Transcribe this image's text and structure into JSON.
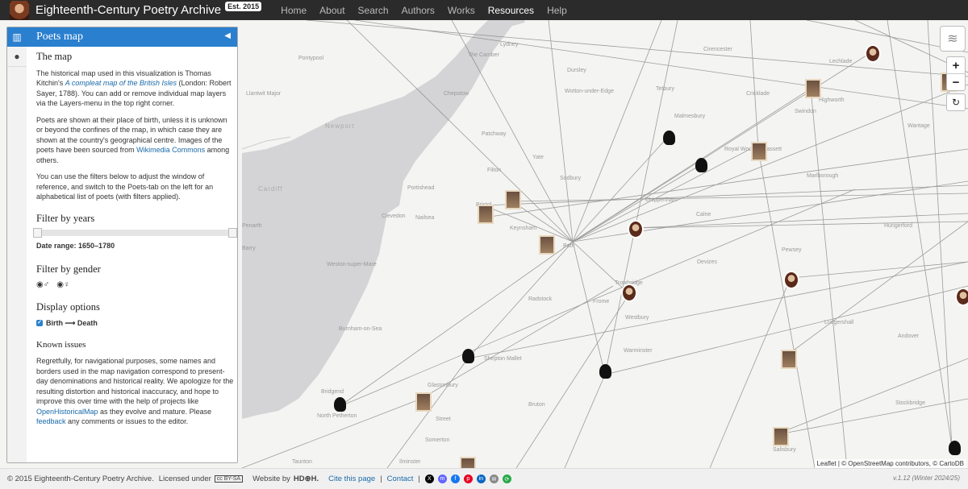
{
  "topnav": {
    "title": "Eighteenth-Century Poetry Archive",
    "badge": "Est. 2015",
    "links": [
      "Home",
      "About",
      "Search",
      "Authors",
      "Works",
      "Resources",
      "Help"
    ],
    "active": "Resources"
  },
  "sidebar": {
    "title": "Poets map",
    "map_heading": "The map",
    "p1_a": "The historical map used in this visualization is Thomas Kitchin's ",
    "p1_link": "A compleat map of the British Isles",
    "p1_b": " (London: Robert Sayer, 1788). You can add or remove individual map layers via the Layers-menu in the top right corner.",
    "p2_a": "Poets are shown at their place of birth, unless it is unknown or beyond the confines of the map, in which case they are shown at the country's geographical centre. Images of the poets have been sourced from ",
    "p2_link": "Wikimedia Commons",
    "p2_b": " among others.",
    "p3": "You can use the filters below to adjust the window of reference, and switch to the Poets-tab on the left for an alphabetical list of poets (with filters applied).",
    "years_heading": "Filter by years",
    "date_range_label": "Date range:",
    "date_range_value": "1650–1780",
    "gender_heading": "Filter by gender",
    "display_heading": "Display options",
    "display_option": "Birth ⟶ Death",
    "issues_heading": "Known issues",
    "issues_a": "Regretfully, for navigational purposes, some names and borders used in the map navigation correspond to present-day denominations and historical reality. We apologize for the resulting distortion and historical inaccuracy, and hope to improve this over time with the help of projects like ",
    "issues_link1": "OpenHistoricalMap",
    "issues_b": " as they evolve and mature. Please ",
    "issues_link2": "feedback",
    "issues_c": " any comments or issues to the editor."
  },
  "map": {
    "places": [
      "Pontypool",
      "Chepstow",
      "Newport",
      "Cardiff",
      "Lydney",
      "The Camber",
      "Cirencester",
      "Lechlade",
      "Dursley",
      "Wotton-under-Edge",
      "Tetbury",
      "Malmesbury",
      "Cricklade",
      "Highworth",
      "Swindon",
      "Wantage",
      "Royal Wootton Bassett",
      "Marlborough",
      "Chippenham",
      "Calne",
      "Hungerford",
      "Devizes",
      "Pewsey",
      "Trowbridge",
      "Westbury",
      "Ludgershall",
      "Warminster",
      "Andover",
      "Shepton Mallet",
      "Glastonbury",
      "Bruton",
      "Stockbridge",
      "Salisbury",
      "Street",
      "Radstock",
      "Frome",
      "Keynsham",
      "Bath",
      "Bristol",
      "Portishead",
      "Clevedon",
      "Nailsea",
      "Weston-super-Mare",
      "Burnham-on-Sea",
      "North Petherton",
      "Somerton",
      "Taunton",
      "Ilminster",
      "Patchway",
      "Filton",
      "Yate",
      "Sodbury",
      "Llantwit Major",
      "Barry",
      "Penarth",
      "Bridgend"
    ],
    "attribution": "Leaflet | © OpenStreetMap contributors, © CartoDB",
    "layers_icon": "layers-icon",
    "zoom_in": "+",
    "zoom_out": "−",
    "reset": "↻"
  },
  "footer": {
    "copyright": "© 2015 Eighteenth-Century Poetry Archive.",
    "licensed": "Licensed under",
    "license_badge": "cc BY-SA",
    "website_by": "Website by",
    "website_by_name": "HD⊕H.",
    "cite": "Cite this page",
    "contact": "Contact",
    "version": "v.1.12 (Winter 2024/25)"
  }
}
